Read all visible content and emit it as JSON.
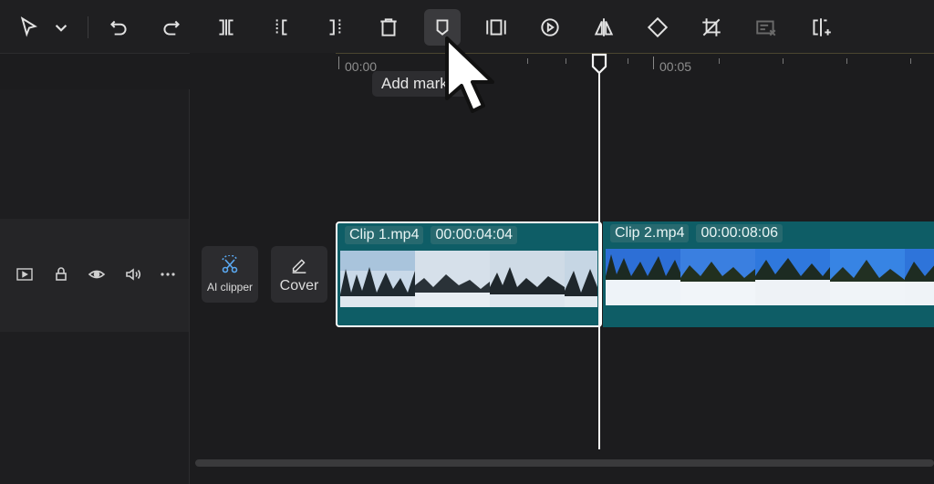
{
  "toolbar": {
    "tools": [
      {
        "name": "select-pointer"
      },
      {
        "name": "select-dropdown"
      },
      {
        "name": "undo"
      },
      {
        "name": "redo"
      },
      {
        "name": "split"
      },
      {
        "name": "split-left"
      },
      {
        "name": "split-right"
      },
      {
        "name": "delete"
      },
      {
        "name": "add-marker",
        "active": true
      },
      {
        "name": "freeze"
      },
      {
        "name": "reverse"
      },
      {
        "name": "mirror"
      },
      {
        "name": "rotate"
      },
      {
        "name": "crop"
      },
      {
        "name": "disabled-edit"
      },
      {
        "name": "replace"
      }
    ]
  },
  "ruler": {
    "time_start": "00:00",
    "time_mid": "00:05"
  },
  "tooltip": {
    "text": "Add marker"
  },
  "track_header": {
    "icons": [
      "video-track-icon",
      "lock-icon",
      "eye-icon",
      "volume-icon",
      "more-icon"
    ]
  },
  "side_buttons": {
    "ai_clipper": "AI clipper",
    "cover": "Cover"
  },
  "clips": [
    {
      "name": "Clip 1.mp4",
      "duration": "00:00:04:04",
      "selected": true
    },
    {
      "name": "Clip 2.mp4",
      "duration": "00:00:08:06",
      "selected": false
    }
  ],
  "colors": {
    "clip_bg": "#0e5d66",
    "chip_bg": "#27696f",
    "toolbar_bg": "#1f1f21",
    "playhead": "#f4f4f4"
  }
}
